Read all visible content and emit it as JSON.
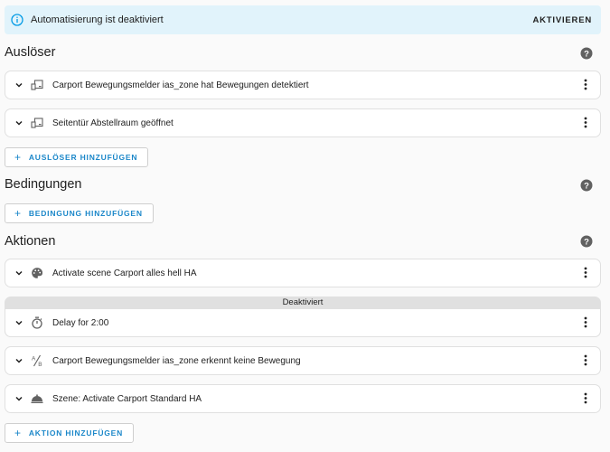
{
  "banner": {
    "message": "Automatisierung ist deaktiviert",
    "action": "AKTIVIEREN",
    "icon": "info-icon"
  },
  "sections": {
    "triggers_title": "Auslöser",
    "conditions_title": "Bedingungen",
    "actions_title": "Aktionen"
  },
  "triggers": [
    {
      "label": "Carport Bewegungsmelder ias_zone hat Bewegungen detektiert",
      "icon": "device-icon"
    },
    {
      "label": "Seitentür Abstellraum geöffnet",
      "icon": "device-icon"
    }
  ],
  "actions": [
    {
      "label": "Activate scene Carport alles hell HA",
      "icon": "palette-icon"
    },
    {
      "label": "Delay for 2:00",
      "icon": "timer-icon",
      "disabled_label": "Deaktiviert"
    },
    {
      "label": "Carport Bewegungsmelder ias_zone erkennt keine Bewegung",
      "icon": "condition-icon"
    },
    {
      "label": "Szene: Activate Carport Standard HA",
      "icon": "scene-icon"
    }
  ],
  "buttons": {
    "add_trigger": "AUSLÖSER HINZUFÜGEN",
    "add_condition": "BEDINGUNG HINZUFÜGEN",
    "add_action": "AKTION HINZUFÜGEN"
  },
  "colors": {
    "banner_bg": "#e1f3fb",
    "info_blue": "#039be5",
    "primary": "#1b87c9",
    "icon_gray": "#616161",
    "disabled_bg": "#e0e0e0"
  }
}
